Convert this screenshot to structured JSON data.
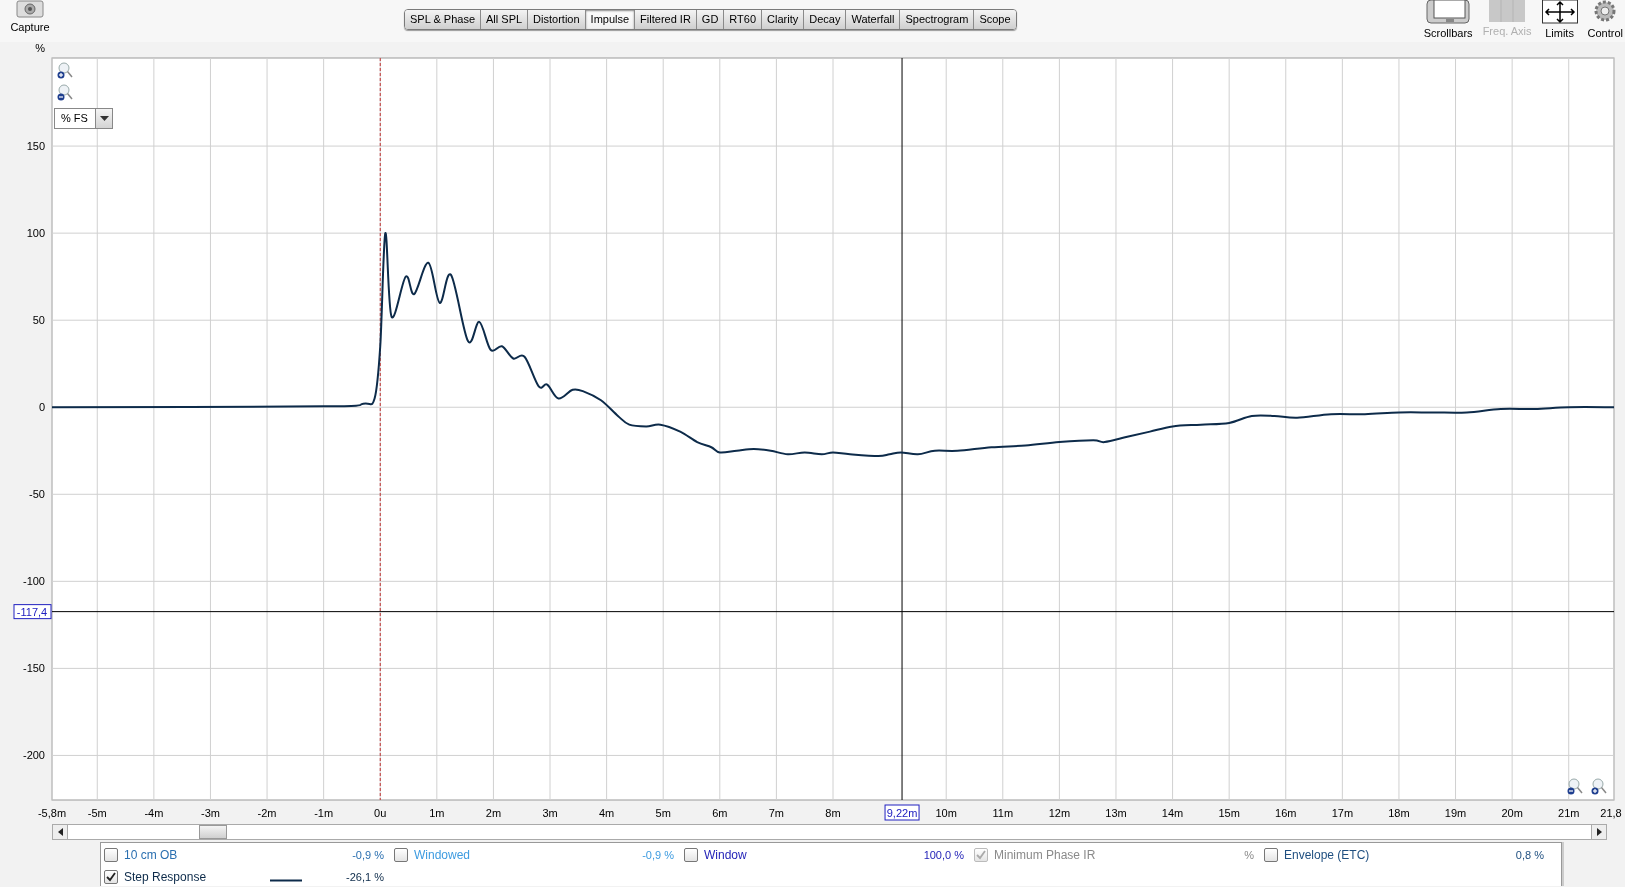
{
  "toolbar": {
    "capture": "Capture",
    "tabs": [
      {
        "label": "SPL & Phase",
        "selected": false
      },
      {
        "label": "All SPL",
        "selected": false
      },
      {
        "label": "Distortion",
        "selected": false
      },
      {
        "label": "Impulse",
        "selected": true
      },
      {
        "label": "Filtered IR",
        "selected": false
      },
      {
        "label": "GD",
        "selected": false
      },
      {
        "label": "RT60",
        "selected": false
      },
      {
        "label": "Clarity",
        "selected": false
      },
      {
        "label": "Decay",
        "selected": false
      },
      {
        "label": "Waterfall",
        "selected": false
      },
      {
        "label": "Spectrogram",
        "selected": false
      },
      {
        "label": "Scope",
        "selected": false
      }
    ],
    "tools": [
      {
        "label": "Scrollbars",
        "kind": "scrollbars",
        "disabled": false
      },
      {
        "label": "Freq. Axis",
        "kind": "axis",
        "disabled": true
      },
      {
        "label": "Limits",
        "kind": "limits",
        "disabled": false
      },
      {
        "label": "Control",
        "kind": "gear",
        "disabled": false
      }
    ]
  },
  "graph": {
    "unit_selector": "% FS",
    "chart_data": {
      "type": "line",
      "ylabel": "%",
      "xlim": [
        -5.8,
        21.8
      ],
      "ylim": [
        -225.6,
        200.6
      ],
      "xticks": [
        {
          "value": -5.8,
          "label": "-5,8m"
        },
        {
          "value": -5,
          "label": "-5m"
        },
        {
          "value": -4,
          "label": "-4m"
        },
        {
          "value": -3,
          "label": "-3m"
        },
        {
          "value": -2,
          "label": "-2m"
        },
        {
          "value": -1,
          "label": "-1m"
        },
        {
          "value": 0,
          "label": "0u"
        },
        {
          "value": 1,
          "label": "1m"
        },
        {
          "value": 2,
          "label": "2m"
        },
        {
          "value": 3,
          "label": "3m"
        },
        {
          "value": 4,
          "label": "4m"
        },
        {
          "value": 5,
          "label": "5m"
        },
        {
          "value": 6,
          "label": "6m"
        },
        {
          "value": 7,
          "label": "7m"
        },
        {
          "value": 8,
          "label": "8m"
        },
        {
          "value": 10,
          "label": "10m"
        },
        {
          "value": 11,
          "label": "11m"
        },
        {
          "value": 12,
          "label": "12m"
        },
        {
          "value": 13,
          "label": "13m"
        },
        {
          "value": 14,
          "label": "14m"
        },
        {
          "value": 15,
          "label": "15m"
        },
        {
          "value": 16,
          "label": "16m"
        },
        {
          "value": 17,
          "label": "17m"
        },
        {
          "value": 18,
          "label": "18m"
        },
        {
          "value": 19,
          "label": "19m"
        },
        {
          "value": 20,
          "label": "20m"
        },
        {
          "value": 21,
          "label": "21m"
        },
        {
          "value": 21.8,
          "label": "21,8"
        }
      ],
      "grid": true,
      "yticks": [
        150,
        100,
        50,
        0,
        -50,
        -100,
        -150,
        -200
      ],
      "x": [
        -5.8,
        -1,
        -0.3,
        -0.1,
        0,
        0.09,
        0.2,
        0.45,
        0.6,
        0.85,
        1.05,
        1.25,
        1.55,
        1.75,
        1.95,
        2.15,
        2.35,
        2.55,
        2.8,
        2.95,
        3.15,
        3.4,
        3.6,
        3.9,
        4.2,
        4.4,
        4.7,
        4.95,
        5.3,
        5.6,
        5.85,
        6,
        6.3,
        6.6,
        6.9,
        7.2,
        7.5,
        7.8,
        8,
        8.3,
        8.8,
        9,
        9.2,
        9.5,
        9.8,
        10.2,
        10.8,
        11.4,
        12,
        12.6,
        12.8,
        13.2,
        13.6,
        14,
        14.5,
        15,
        15.4,
        15.8,
        16.2,
        16.8,
        17.4,
        18,
        18.6,
        19.2,
        19.8,
        20.4,
        21,
        21.8
      ],
      "series": [
        {
          "name": "Step Response",
          "color": "#0d2b4a",
          "values": [
            0,
            0.5,
            2,
            5,
            35,
            100,
            52,
            75,
            65,
            83,
            60,
            76,
            38,
            49,
            33,
            35,
            28,
            29,
            12,
            13,
            5,
            10,
            9,
            4,
            -5,
            -10,
            -11,
            -10,
            -14,
            -20,
            -23,
            -26,
            -25,
            -24,
            -25,
            -27,
            -26,
            -27,
            -26,
            -27,
            -28,
            -27,
            -26,
            -27,
            -25,
            -25,
            -23,
            -22,
            -20,
            -19,
            -20,
            -17,
            -14,
            -11,
            -10,
            -9,
            -5,
            -5,
            -6,
            -4,
            -4,
            -3,
            -3,
            -3,
            -1,
            -1,
            0,
            0
          ]
        }
      ],
      "ref_lines": [
        {
          "axis": "x",
          "value": 0,
          "color": "#c03030"
        },
        {
          "axis": "x",
          "value": 9.22,
          "color": "#000000",
          "label": "9,22m"
        },
        {
          "axis": "y",
          "value": -117.4,
          "color": "#000000",
          "label": "-117,4"
        }
      ]
    }
  },
  "legend": [
    {
      "label": "10 cm OB",
      "value": "-0,9 %",
      "color": "#2a6fb0",
      "checked": false,
      "disabled": false
    },
    {
      "label": "Windowed",
      "value": "-0,9 %",
      "color": "#3d9be0",
      "checked": false,
      "disabled": false
    },
    {
      "label": "Window",
      "value": "100,0 %",
      "color": "#2424b8",
      "checked": false,
      "disabled": false
    },
    {
      "label": "Minimum Phase IR",
      "value": "%",
      "color": "#8a8a8a",
      "checked": true,
      "disabled": true
    },
    {
      "label": "Envelope (ETC)",
      "value": "0,8 %",
      "color": "#1f4f80",
      "checked": false,
      "disabled": false
    },
    {
      "kind": "series",
      "value": "-26,1 %",
      "color": "#0d2b4a",
      "checked": true,
      "disabled": false,
      "swatch": true
    }
  ]
}
